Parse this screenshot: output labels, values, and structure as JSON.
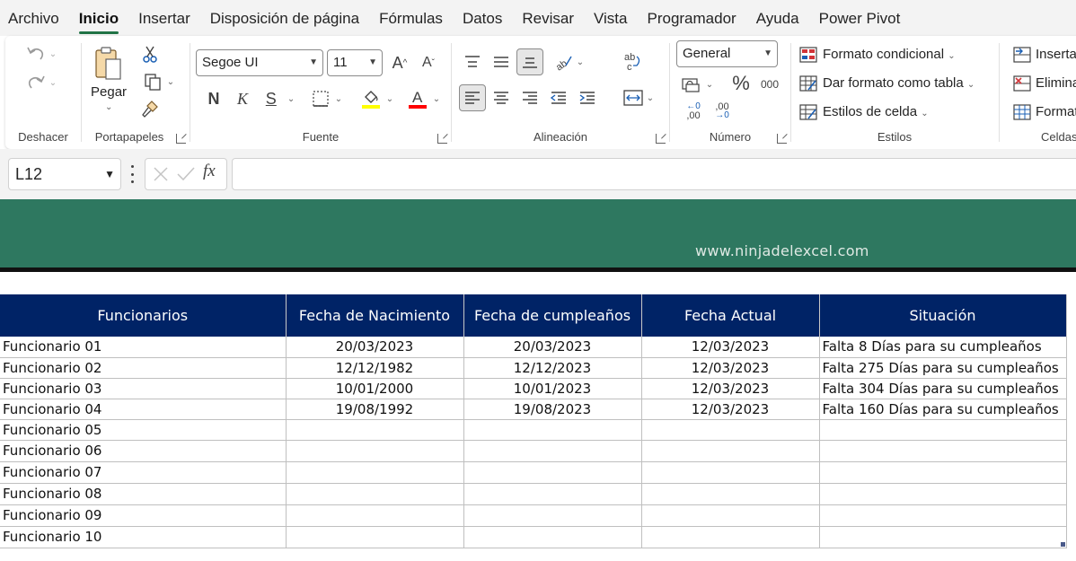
{
  "menu": {
    "tabs": [
      "Archivo",
      "Inicio",
      "Insertar",
      "Disposición de página",
      "Fórmulas",
      "Datos",
      "Revisar",
      "Vista",
      "Programador",
      "Ayuda",
      "Power Pivot"
    ],
    "active": "Inicio"
  },
  "ribbon": {
    "undo": {
      "label": "Deshacer"
    },
    "clipboard": {
      "paste_label": "Pegar",
      "label": "Portapapeles"
    },
    "font": {
      "family": "Segoe UI",
      "size": "11",
      "label": "Fuente",
      "highlight_color": "#ffff00",
      "font_color": "#ff0000"
    },
    "alignment": {
      "label": "Alineación"
    },
    "number": {
      "format": "General",
      "percent": "%",
      "thousands": "000",
      "inc_decimal": ",00",
      "dec_decimal": ",00",
      "label": "Número"
    },
    "styles": {
      "conditional": "Formato condicional",
      "as_table": "Dar formato como tabla",
      "cell_styles": "Estilos de celda",
      "label": "Estilos"
    },
    "cells": {
      "insert": "Inserta",
      "delete": "Elimina",
      "format": "Format",
      "label": "Celdas"
    }
  },
  "formula_bar": {
    "name_box": "L12",
    "fx": "fx",
    "value": ""
  },
  "banner": {
    "url": "www.ninjadelexcel.com",
    "color": "#2e7860"
  },
  "table": {
    "header_color": "#002366",
    "headers": [
      "Funcionarios",
      "Fecha de Nacimiento",
      "Fecha de cumpleaños",
      "Fecha Actual",
      "Situación"
    ],
    "rows": [
      [
        "Funcionario 01",
        "20/03/2023",
        "20/03/2023",
        "12/03/2023",
        "Falta 8 Días para su cumpleaños"
      ],
      [
        "Funcionario 02",
        "12/12/1982",
        "12/12/2023",
        "12/03/2023",
        "Falta 275 Días para su cumpleaños"
      ],
      [
        "Funcionario 03",
        "10/01/2000",
        "10/01/2023",
        "12/03/2023",
        "Falta 304 Días para su cumpleaños"
      ],
      [
        "Funcionario 04",
        "19/08/1992",
        "19/08/2023",
        "12/03/2023",
        "Falta 160 Días para su cumpleaños"
      ],
      [
        "Funcionario 05",
        "",
        "",
        "",
        ""
      ],
      [
        "Funcionario 06",
        "",
        "",
        "",
        ""
      ],
      [
        "Funcionario 07",
        "",
        "",
        "",
        ""
      ],
      [
        "Funcionario 08",
        "",
        "",
        "",
        ""
      ],
      [
        "Funcionario 09",
        "",
        "",
        "",
        ""
      ],
      [
        "Funcionario 10",
        "",
        "",
        "",
        ""
      ]
    ]
  }
}
